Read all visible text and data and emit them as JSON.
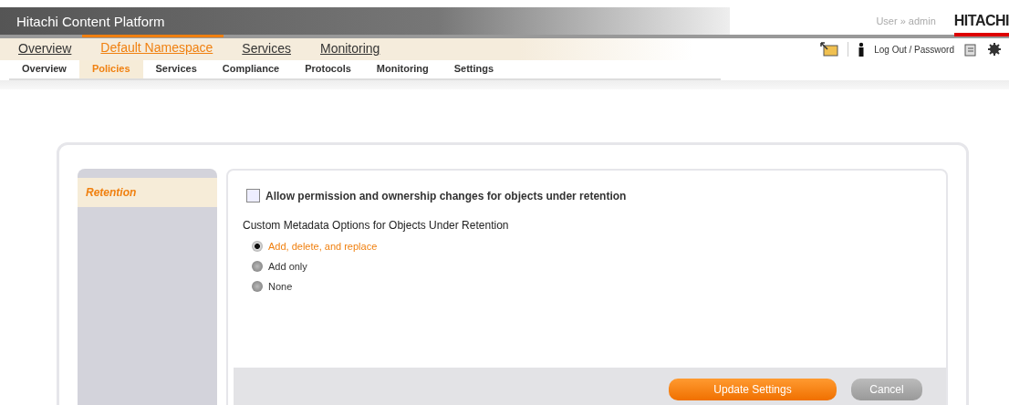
{
  "header": {
    "title": "Hitachi Content Platform",
    "user": "User » admin",
    "brand": "HITACHI"
  },
  "main_tabs": [
    {
      "label": "Overview",
      "selected": false
    },
    {
      "label": "Default Namespace",
      "selected": true
    },
    {
      "label": "Services",
      "selected": false
    },
    {
      "label": "Monitoring",
      "selected": false
    }
  ],
  "utility": {
    "logout": "Log Out / Password"
  },
  "sub_tabs": [
    {
      "label": "Overview",
      "selected": false
    },
    {
      "label": "Policies",
      "selected": true
    },
    {
      "label": "Services",
      "selected": false
    },
    {
      "label": "Compliance",
      "selected": false
    },
    {
      "label": "Protocols",
      "selected": false
    },
    {
      "label": "Monitoring",
      "selected": false
    },
    {
      "label": "Settings",
      "selected": false
    }
  ],
  "sidebar": {
    "items": [
      {
        "label": "Retention",
        "selected": true
      }
    ]
  },
  "form": {
    "checkbox": {
      "label": "Allow permission and ownership changes for objects under retention",
      "checked": false
    },
    "group_label": "Custom Metadata Options for Objects Under Retention",
    "options": [
      {
        "label": "Add, delete, and replace",
        "selected": true
      },
      {
        "label": "Add only",
        "selected": false
      },
      {
        "label": "None",
        "selected": false
      }
    ]
  },
  "buttons": [
    {
      "label": "Update Settings",
      "kind": "primary"
    },
    {
      "label": "Cancel",
      "kind": "secondary"
    }
  ]
}
